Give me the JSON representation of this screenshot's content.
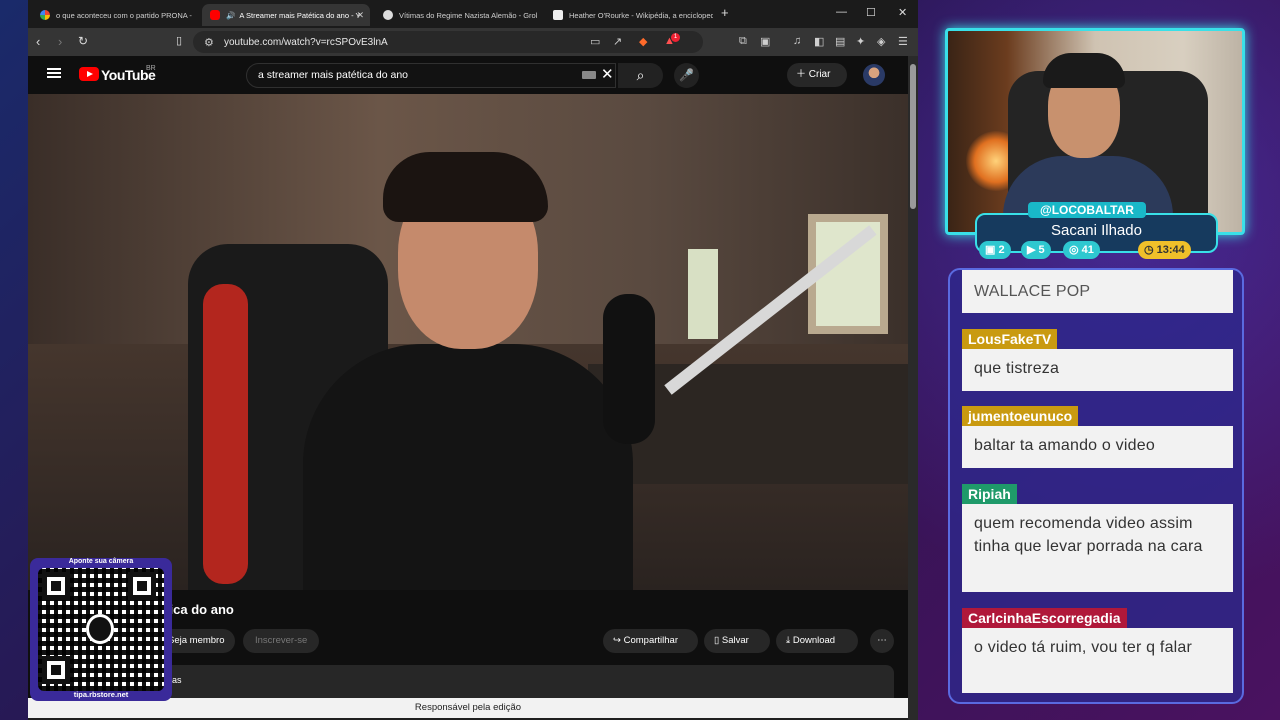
{
  "browser": {
    "tabs": [
      {
        "title": "o que aconteceu com o partido PRONA - Pe",
        "favicon": "google"
      },
      {
        "title": "A Streamer mais Patética do ano - Y",
        "favicon": "youtube",
        "active": true
      },
      {
        "title": "Vítimas do Regime Nazista Alemão - Grok",
        "favicon": "grok"
      },
      {
        "title": "Heather O'Rourke - Wikipédia, a encicloped",
        "favicon": "wikipedia"
      }
    ],
    "new_tab": "+",
    "url": "youtube.com/watch?v=rcSPOvE3lnA",
    "badge_count": "1"
  },
  "youtube": {
    "logo_text": "YouTube",
    "country": "BR",
    "search_query": "a streamer mais patética do ano",
    "create_label": "Criar",
    "video_title_partial": "ética do ano",
    "join_label": "Seja membro",
    "subscribe_label": "Inscrever-se",
    "share_label": "Compartilhar",
    "save_label": "Salvar",
    "download_label": "Download",
    "description_partial": "lias",
    "status_text": "Responsável pela edição"
  },
  "qr": {
    "top_text": "Aponte sua câmera",
    "bottom_text": "tipa.rbstore.net"
  },
  "stream": {
    "handle": "@LOCOBALTAR",
    "name": "Sacani Ilhado",
    "stats": {
      "chat": "2",
      "videos": "5",
      "viewers": "41",
      "time": "13:44"
    }
  },
  "chat": {
    "partial_top": "WALLACE POP",
    "messages": [
      {
        "user": "LousFakeTV",
        "text": "que tistreza",
        "color": "#c99a10"
      },
      {
        "user": "jumentoeunuco",
        "text": "baltar ta amando o video",
        "color": "#c99a10"
      },
      {
        "user": "Ripiah",
        "text": "quem recomenda video assim tinha que levar porrada na cara",
        "color": "#1f9a6a"
      },
      {
        "user": "CarlcinhaEscorregadia",
        "text": "o video tá ruim, vou ter q falar",
        "color": "#b0183a"
      }
    ]
  }
}
